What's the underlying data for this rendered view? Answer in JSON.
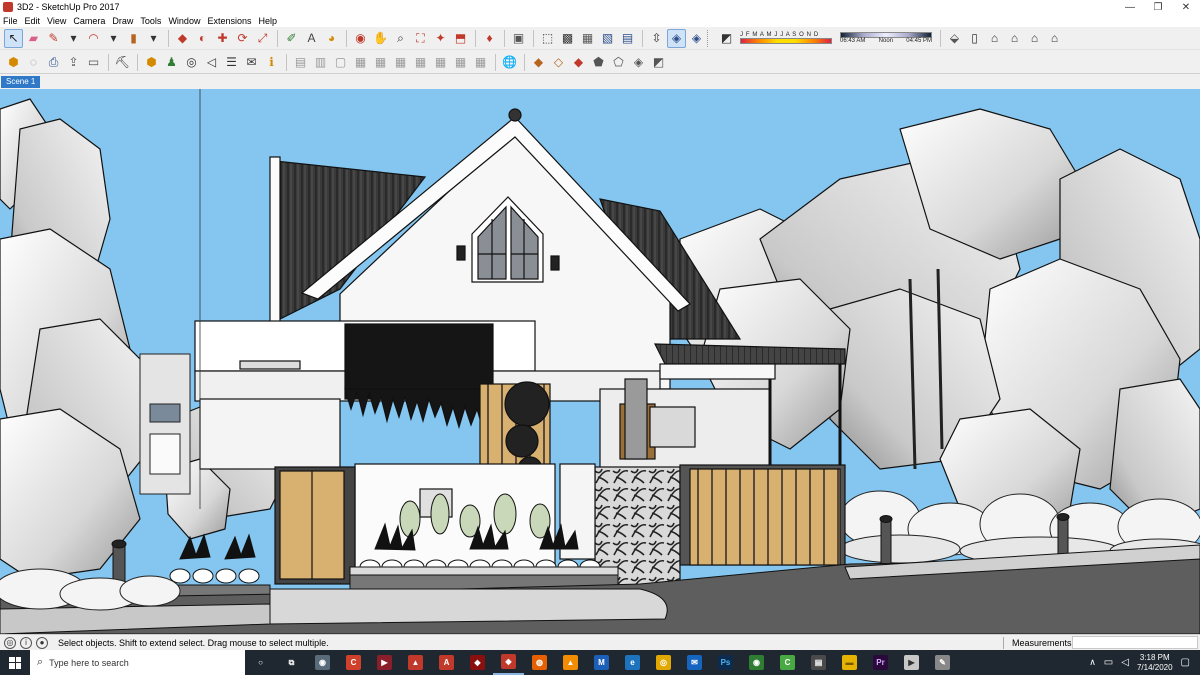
{
  "window": {
    "title": "3D2 - SketchUp Pro 2017",
    "controls": {
      "minimize": "—",
      "restore": "❐",
      "close": "✕"
    }
  },
  "menubar": [
    "File",
    "Edit",
    "View",
    "Camera",
    "Draw",
    "Tools",
    "Window",
    "Extensions",
    "Help"
  ],
  "toolbar1": {
    "groups": [
      [
        {
          "name": "select-tool-icon",
          "glyph": "↖",
          "color": "#222",
          "active": true
        },
        {
          "name": "eraser-tool-icon",
          "glyph": "▰",
          "color": "#d9608a"
        },
        {
          "name": "line-tool-icon",
          "glyph": "✎",
          "color": "#c0392b"
        },
        {
          "name": "line-dropdown-icon",
          "glyph": "▾",
          "color": "#333"
        },
        {
          "name": "arc-tool-icon",
          "glyph": "◠",
          "color": "#c0392b"
        },
        {
          "name": "arc-dropdown-icon",
          "glyph": "▾",
          "color": "#333"
        },
        {
          "name": "rectangle-tool-icon",
          "glyph": "▮",
          "color": "#b5651d"
        },
        {
          "name": "shape-dropdown-icon",
          "glyph": "▾",
          "color": "#333"
        }
      ],
      [
        {
          "name": "push-pull-tool-icon",
          "glyph": "◆",
          "color": "#c0392b"
        },
        {
          "name": "offset-tool-icon",
          "glyph": "◐",
          "color": "#c0392b"
        },
        {
          "name": "move-tool-icon",
          "glyph": "✚",
          "color": "#c0392b"
        },
        {
          "name": "rotate-tool-icon",
          "glyph": "⟳",
          "color": "#c0392b"
        },
        {
          "name": "scale-tool-icon",
          "glyph": "⤢",
          "color": "#c0392b"
        }
      ],
      [
        {
          "name": "tape-measure-icon",
          "glyph": "✐",
          "color": "#2e7d32"
        },
        {
          "name": "text-tool-icon",
          "glyph": "A",
          "color": "#444"
        },
        {
          "name": "paint-bucket-icon",
          "glyph": "◕",
          "color": "#d48a00"
        }
      ],
      [
        {
          "name": "orbit-tool-icon",
          "glyph": "◉",
          "color": "#c0392b"
        },
        {
          "name": "pan-tool-icon",
          "glyph": "✋",
          "color": "#d8a000"
        },
        {
          "name": "zoom-tool-icon",
          "glyph": "⌕",
          "color": "#333"
        },
        {
          "name": "zoom-extents-icon",
          "glyph": "⛶",
          "color": "#c0392b"
        },
        {
          "name": "warehouse-icon",
          "glyph": "✦",
          "color": "#c0392b"
        },
        {
          "name": "share-model-icon",
          "glyph": "⬒",
          "color": "#c0392b"
        }
      ],
      [
        {
          "name": "ruby-console-icon",
          "glyph": "♦",
          "color": "#c0392b"
        }
      ],
      [
        {
          "name": "xray-style-icon",
          "glyph": "▣",
          "color": "#555"
        }
      ],
      [
        {
          "name": "wireframe-style-icon",
          "glyph": "⬚",
          "color": "#333"
        },
        {
          "name": "hidden-line-style-icon",
          "glyph": "▩",
          "color": "#333"
        },
        {
          "name": "shaded-style-icon",
          "glyph": "▦",
          "color": "#555"
        },
        {
          "name": "shaded-textures-style-icon",
          "glyph": "▧",
          "color": "#2c4f8a"
        },
        {
          "name": "monochrome-style-icon",
          "glyph": "▤",
          "color": "#2c4f8a"
        }
      ],
      [
        {
          "name": "section-plane-icon",
          "glyph": "⇳",
          "color": "#333"
        },
        {
          "name": "display-section-planes-icon",
          "glyph": "◈",
          "color": "#2c4f8a",
          "active": true
        },
        {
          "name": "display-section-cuts-icon",
          "glyph": "◈",
          "color": "#2c4f8a"
        }
      ]
    ],
    "shadows": {
      "toggle_icon": "◩",
      "months": "J F M A M J J A S O N D",
      "time_start": "06:43 AM",
      "time_mid": "Noon",
      "time_end": "04:45 PM"
    },
    "views": [
      {
        "name": "iso-view-icon",
        "glyph": "⬙",
        "color": "#555"
      },
      {
        "name": "top-view-icon",
        "glyph": "▯",
        "color": "#333"
      },
      {
        "name": "front-view-icon",
        "glyph": "⌂",
        "color": "#333"
      },
      {
        "name": "right-view-icon",
        "glyph": "⌂",
        "color": "#333"
      },
      {
        "name": "back-view-icon",
        "glyph": "⌂",
        "color": "#333"
      },
      {
        "name": "left-view-icon",
        "glyph": "⌂",
        "color": "#333"
      }
    ]
  },
  "toolbar2": {
    "groups": [
      [
        {
          "name": "component-shield-icon",
          "glyph": "⬢",
          "color": "#d48a00"
        },
        {
          "name": "sandbox-icon",
          "glyph": "◌",
          "color": "#888"
        },
        {
          "name": "print-icon",
          "glyph": "⎙",
          "color": "#2c4f8a"
        },
        {
          "name": "import-icon",
          "glyph": "⇪",
          "color": "#555"
        },
        {
          "name": "camera-tool-icon",
          "glyph": "▭",
          "color": "#555"
        }
      ],
      [
        {
          "name": "solid-tools-icon",
          "glyph": "⛏",
          "color": "#333"
        }
      ],
      [
        {
          "name": "add-component-icon",
          "glyph": "⬢",
          "color": "#d48a00"
        },
        {
          "name": "person-icon",
          "glyph": "♟",
          "color": "#2e7d32"
        },
        {
          "name": "target-icon",
          "glyph": "◎",
          "color": "#333"
        },
        {
          "name": "sound-icon",
          "glyph": "◁",
          "color": "#333"
        },
        {
          "name": "settings-sliders-icon",
          "glyph": "☰",
          "color": "#333"
        },
        {
          "name": "chat-icon",
          "glyph": "✉",
          "color": "#333"
        },
        {
          "name": "info-icon",
          "glyph": "ℹ",
          "color": "#d48a00"
        }
      ],
      [
        {
          "name": "standard-new-icon",
          "glyph": "▤",
          "color": "#999"
        },
        {
          "name": "standard-open-icon",
          "glyph": "▥",
          "color": "#999"
        },
        {
          "name": "standard-save-icon",
          "glyph": "▢",
          "color": "#999"
        },
        {
          "name": "standard-cut-icon",
          "glyph": "▦",
          "color": "#999"
        },
        {
          "name": "standard-copy-icon",
          "glyph": "▦",
          "color": "#999"
        },
        {
          "name": "standard-paste-icon",
          "glyph": "▦",
          "color": "#999"
        },
        {
          "name": "standard-erase-icon",
          "glyph": "▦",
          "color": "#999"
        },
        {
          "name": "standard-undo-icon",
          "glyph": "▦",
          "color": "#999"
        },
        {
          "name": "standard-redo-icon",
          "glyph": "▦",
          "color": "#999"
        },
        {
          "name": "standard-print-icon",
          "glyph": "▦",
          "color": "#999"
        }
      ],
      [
        {
          "name": "geo-location-icon",
          "glyph": "🌐",
          "color": "#333"
        }
      ],
      [
        {
          "name": "sandbox-from-contours-icon",
          "glyph": "◆",
          "color": "#b5651d"
        },
        {
          "name": "sandbox-from-scratch-icon",
          "glyph": "◇",
          "color": "#b5651d"
        },
        {
          "name": "smoove-icon",
          "glyph": "◆",
          "color": "#c0392b"
        },
        {
          "name": "stamp-icon",
          "glyph": "⬟",
          "color": "#555"
        },
        {
          "name": "drape-icon",
          "glyph": "⬠",
          "color": "#555"
        },
        {
          "name": "add-detail-icon",
          "glyph": "◈",
          "color": "#555"
        },
        {
          "name": "flip-edge-icon",
          "glyph": "◩",
          "color": "#555"
        }
      ]
    ]
  },
  "scene_tab": "Scene 1",
  "statusbar": {
    "hint": "Select objects. Shift to extend select. Drag mouse to select multiple.",
    "measurements_label": "Measurements",
    "icons": [
      "geo-icon",
      "credits-icon",
      "user-icon"
    ]
  },
  "taskbar": {
    "search_placeholder": "Type here to search",
    "apps": [
      {
        "name": "cortana-icon",
        "glyph": "○",
        "color": "transparent",
        "fg": "#fff"
      },
      {
        "name": "task-view-icon",
        "glyph": "⧉",
        "color": "transparent",
        "fg": "#fff"
      },
      {
        "name": "camera-app-icon",
        "glyph": "◉",
        "color": "#5a6b7a",
        "fg": "#fff"
      },
      {
        "name": "red-app-icon",
        "glyph": "C",
        "color": "#d0402a",
        "fg": "#fff"
      },
      {
        "name": "media-player-icon",
        "glyph": "▶",
        "color": "#8a1f2a",
        "fg": "#fff"
      },
      {
        "name": "layout-app-icon",
        "glyph": "▲",
        "color": "#c0392b",
        "fg": "#fff"
      },
      {
        "name": "acrobat-icon",
        "glyph": "A",
        "color": "#c0392b",
        "fg": "#fff"
      },
      {
        "name": "design-app-icon",
        "glyph": "◆",
        "color": "#8a1010",
        "fg": "#fff"
      },
      {
        "name": "sketchup-icon",
        "glyph": "◆",
        "color": "#c0392b",
        "fg": "#fff",
        "running": true
      },
      {
        "name": "firefox-icon",
        "glyph": "◍",
        "color": "#e66000",
        "fg": "#fff"
      },
      {
        "name": "vlc-icon",
        "glyph": "▲",
        "color": "#f28c00",
        "fg": "#fff"
      },
      {
        "name": "malwarebytes-icon",
        "glyph": "M",
        "color": "#1c5fb8",
        "fg": "#fff"
      },
      {
        "name": "edge-icon",
        "glyph": "e",
        "color": "#1e73be",
        "fg": "#fff"
      },
      {
        "name": "chrome-icon",
        "glyph": "◎",
        "color": "#e0a800",
        "fg": "#fff"
      },
      {
        "name": "mail-icon",
        "glyph": "✉",
        "color": "#1565c0",
        "fg": "#fff"
      },
      {
        "name": "photoshop-icon",
        "glyph": "Ps",
        "color": "#0d2b4d",
        "fg": "#4ab3f4"
      },
      {
        "name": "nvidia-icon",
        "glyph": "◉",
        "color": "#2e7d32",
        "fg": "#fff"
      },
      {
        "name": "camtasia-icon",
        "glyph": "C",
        "color": "#49a942",
        "fg": "#fff"
      },
      {
        "name": "store-icon",
        "glyph": "▤",
        "color": "#4a4a4a",
        "fg": "#fff"
      },
      {
        "name": "folder-icon",
        "glyph": "▬",
        "color": "#e6b400",
        "fg": "#7a5a00"
      },
      {
        "name": "premiere-icon",
        "glyph": "Pr",
        "color": "#2a0a3a",
        "fg": "#d9a6ff"
      },
      {
        "name": "player-app-icon",
        "glyph": "▶",
        "color": "#c8c8c8",
        "fg": "#333"
      },
      {
        "name": "tool-app-icon",
        "glyph": "✎",
        "color": "#888",
        "fg": "#fff"
      }
    ],
    "time": "3:18 PM",
    "date": "7/14/2020"
  }
}
